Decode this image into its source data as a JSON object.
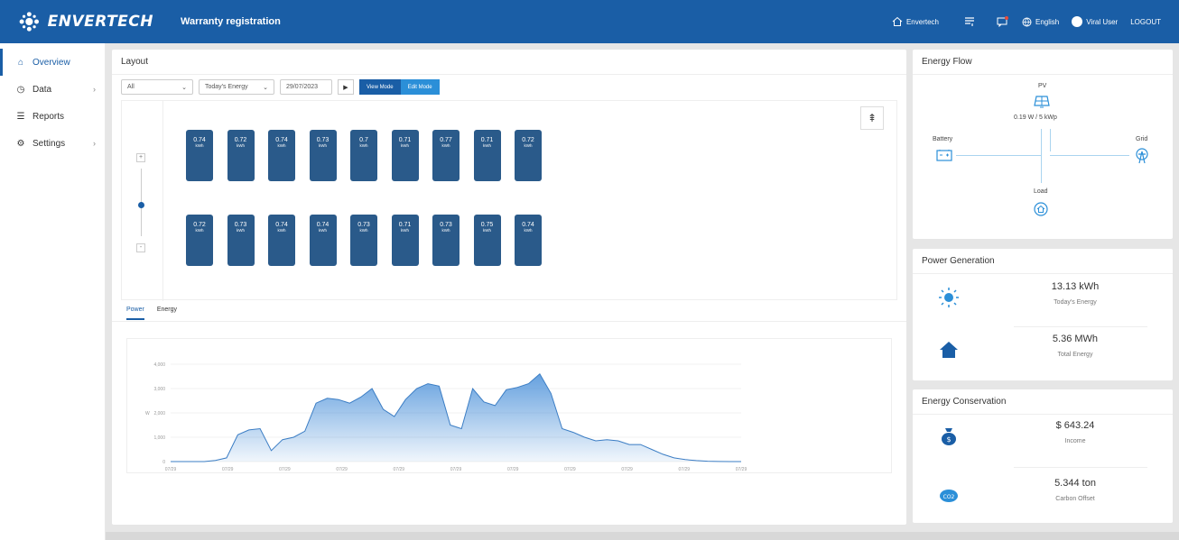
{
  "header": {
    "brand": "ENVERTECH",
    "app_title": "Warranty registration",
    "station_name": "Envertech",
    "language": "English",
    "user": "Viral User",
    "logout": "LOGOUT"
  },
  "sidebar": {
    "items": [
      {
        "label": "Overview",
        "icon": "home-icon"
      },
      {
        "label": "Data",
        "icon": "clock-icon"
      },
      {
        "label": "Reports",
        "icon": "report-icon"
      },
      {
        "label": "Settings",
        "icon": "gear-icon"
      }
    ]
  },
  "layout": {
    "title": "Layout",
    "filter_all": "All",
    "metric_select": "Today's Energy",
    "date": "29/07/2023",
    "view_mode": "View Mode",
    "edit_mode": "Edit Mode",
    "modules_row1": [
      "0.74",
      "0.72",
      "0.74",
      "0.73",
      "0.7",
      "0.71",
      "0.77",
      "0.71",
      "0.72"
    ],
    "modules_row2": [
      "0.72",
      "0.73",
      "0.74",
      "0.74",
      "0.73",
      "0.71",
      "0.73",
      "0.75",
      "0.74"
    ],
    "module_unit": "kWh",
    "tabs": [
      "Power",
      "Energy"
    ]
  },
  "chart_data": {
    "type": "area",
    "ylabel": "W",
    "ylim": [
      0,
      4000
    ],
    "y_ticks": [
      "0",
      "1,000",
      "2,000",
      "3,000",
      "4,000"
    ],
    "x_ticks": [
      "07/29",
      "07/29",
      "07/29",
      "07/29",
      "07/29",
      "07/29",
      "07/29",
      "07/29",
      "07/29",
      "07/29",
      "07/29"
    ],
    "color": "#4a90d9",
    "series": [
      {
        "values": [
          0,
          0,
          0,
          0,
          50,
          150,
          1100,
          1300,
          1350,
          450,
          900,
          1000,
          1250,
          2400,
          2600,
          2550,
          2400,
          2650,
          3000,
          2150,
          1850,
          2550,
          3000,
          3200,
          3100,
          1500,
          1350,
          3000,
          2450,
          2300,
          2950,
          3050,
          3200,
          3600,
          2800,
          1350,
          1200,
          1000,
          850,
          900,
          850,
          700,
          700,
          500,
          300,
          150,
          80,
          40,
          15,
          5,
          0,
          0
        ]
      }
    ]
  },
  "energy_flow": {
    "title": "Energy Flow",
    "pv_label": "PV",
    "pv_value": "0.19 W / 5 kWp",
    "battery_label": "Battery",
    "grid_label": "Grid",
    "load_label": "Load"
  },
  "power_generation": {
    "title": "Power Generation",
    "today_value": "13.13 kWh",
    "today_label": "Today's Energy",
    "total_value": "5.36 MWh",
    "total_label": "Total Energy"
  },
  "energy_conservation": {
    "title": "Energy Conservation",
    "income_value": "$ 643.24",
    "income_label": "Income",
    "carbon_value": "5.344 ton",
    "carbon_label": "Carbon Offset"
  }
}
